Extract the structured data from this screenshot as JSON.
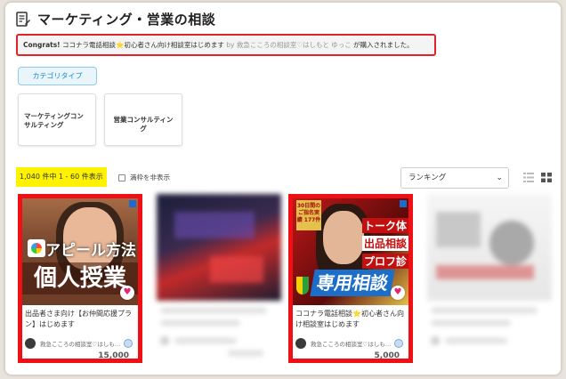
{
  "page": {
    "title": "マーケティング・営業の相談"
  },
  "notice": {
    "lead": "Congrats!",
    "text_before_star": "ココナラ電話相談",
    "star": "⭐",
    "text_after_star": "初心者さん向け相談室はじめます",
    "by": "by 救急こころの相談室♡はしもと ゆっこ",
    "tail": "が購入されました。"
  },
  "category_tab": {
    "label": "カテゴリタイプ"
  },
  "category_cards": [
    {
      "label": "マーケティングコンサルティング"
    },
    {
      "label": "営業コンサルティング"
    }
  ],
  "results": {
    "count_text": "1,040 件中 1 - 60 件表示",
    "hide_full_label": "満枠を非表示"
  },
  "sort": {
    "selected": "ランキング"
  },
  "icons": {
    "view_list": "list-view-icon",
    "view_grid": "grid-view-icon",
    "favorite": "heart-icon",
    "caret": "chevron-down-icon"
  },
  "colors": {
    "highlight_red": "#ef1016",
    "count_yellow": "#fff200",
    "accent_blue": "#1c8ac9",
    "fav_pink": "#e3266d"
  },
  "cards": [
    {
      "thumb_text_1": "アピール方法",
      "thumb_text_2": "個人授業",
      "title": "出品者さま向け【お仲間応援プラン】はじめます",
      "seller": "救急こころの相談室♡はしも…",
      "price": "15,000"
    },
    {
      "thumb_ribbon": "30日間の ご指名実績 177件",
      "thumb_label_1": "トーク体",
      "thumb_label_2": "出品相談",
      "thumb_label_3": "プロフ診",
      "thumb_bottom": "専用相談",
      "title_before_star": "ココナラ電話相談",
      "star": "⭐",
      "title_after_star": "初心者さん向け相談室はじめます",
      "seller": "救急こころの相談室♡はしも…",
      "price": "5,000"
    }
  ]
}
